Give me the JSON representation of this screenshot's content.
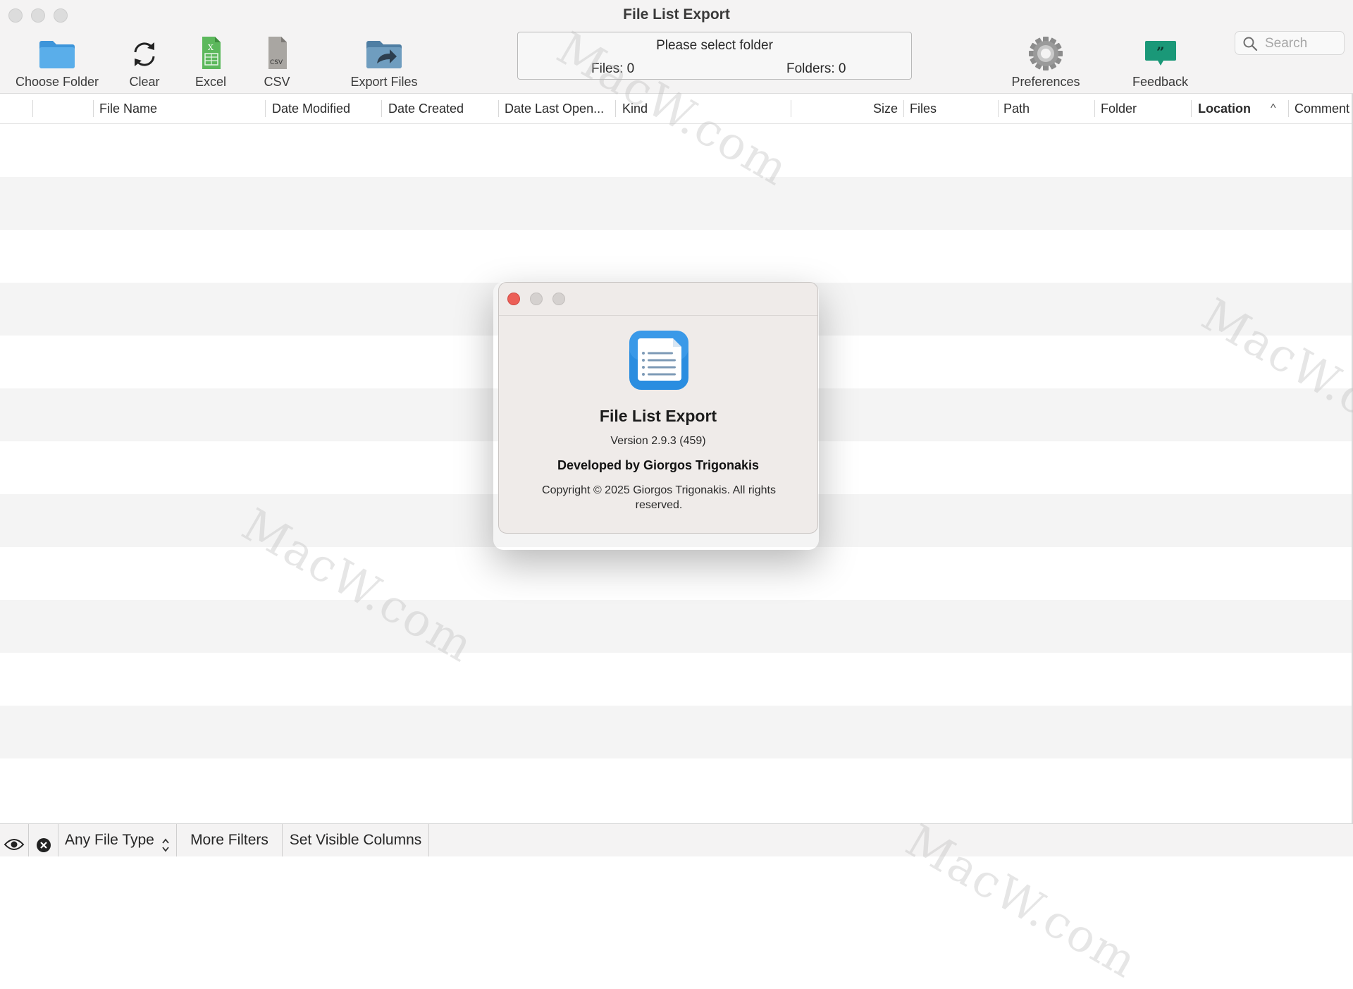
{
  "window": {
    "title": "File List Export"
  },
  "toolbar": {
    "choose_folder": "Choose Folder",
    "clear": "Clear",
    "excel": "Excel",
    "csv": "CSV",
    "csv_icon_text": "CSV",
    "excel_icon_text": "X",
    "export_files": "Export Files",
    "preferences": "Preferences",
    "feedback": "Feedback",
    "feedback_icon_text": "”"
  },
  "status": {
    "message": "Please select folder",
    "files": "Files: 0",
    "folders": "Folders: 0"
  },
  "search": {
    "placeholder": "Search"
  },
  "table": {
    "columns": {
      "file_name": "File Name",
      "date_modified": "Date Modified",
      "date_created": "Date Created",
      "date_last_opened": "Date Last Open...",
      "kind": "Kind",
      "size": "Size",
      "files": "Files",
      "path": "Path",
      "folder": "Folder",
      "location": "Location",
      "comment": "Comment"
    },
    "sorted_column": "Location",
    "sort_indicator": "^",
    "rows": []
  },
  "bottom_bar": {
    "file_type": "Any File Type",
    "more_filters": "More Filters",
    "set_visible_columns": "Set Visible Columns"
  },
  "about": {
    "app_name": "File List Export",
    "version": "Version 2.9.3 (459)",
    "developer": "Developed by Giorgos Trigonakis",
    "copyright": "Copyright © 2025 Giorgos Trigonakis. All rights reserved."
  },
  "watermark": {
    "text": "MacW.com"
  },
  "colors": {
    "close_red": "#ec5f57",
    "folder_blue": "#5aaeea",
    "excel_green": "#5cb85c",
    "feedback_teal": "#1a9878",
    "app_icon_blue": "#2a8de0"
  }
}
